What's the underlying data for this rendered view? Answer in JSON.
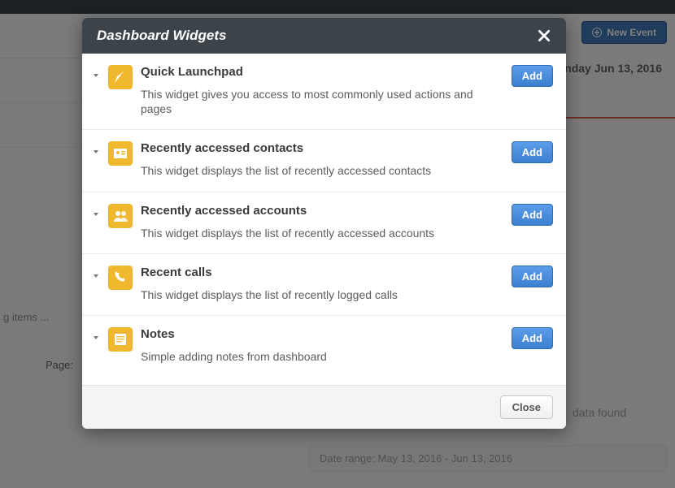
{
  "background": {
    "items_label": "g items ...",
    "page_label": "Page:",
    "new_event_label": "New Event",
    "monday_label": "onday Jun 13, 2016",
    "no_data_label": "data found",
    "date_range_label": "Date range: May 13, 2016 - Jun 13, 2016"
  },
  "modal": {
    "title": "Dashboard Widgets",
    "add_label": "Add",
    "close_label": "Close",
    "widgets": [
      {
        "title": "Quick Launchpad",
        "desc": "This widget gives you access to most commonly used actions and pages",
        "icon": "rocket"
      },
      {
        "title": "Recently accessed contacts",
        "desc": "This widget displays the list of recently accessed contacts",
        "icon": "contact"
      },
      {
        "title": "Recently accessed accounts",
        "desc": "This widget displays the list of recently accessed accounts",
        "icon": "accounts"
      },
      {
        "title": "Recent calls",
        "desc": "This widget displays the list of recently logged calls",
        "icon": "phone"
      },
      {
        "title": "Notes",
        "desc": "Simple adding notes from dashboard",
        "icon": "note"
      }
    ]
  }
}
